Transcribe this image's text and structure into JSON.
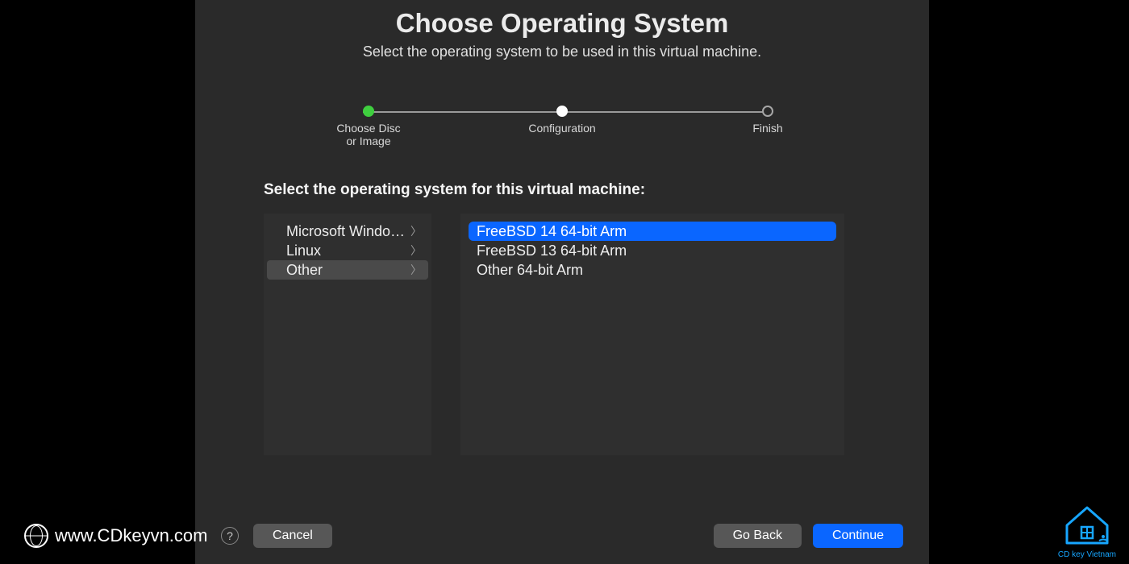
{
  "header": {
    "title": "Choose Operating System",
    "subtitle": "Select the operating system to be used in this virtual machine."
  },
  "stepper": {
    "steps": [
      {
        "label": "Choose Disc\nor Image",
        "state": "done"
      },
      {
        "label": "Configuration",
        "state": "current"
      },
      {
        "label": "Finish",
        "state": "future"
      }
    ]
  },
  "section_label": "Select the operating system for this virtual machine:",
  "categories": [
    {
      "label": "Microsoft Windo…",
      "selected": false
    },
    {
      "label": "Linux",
      "selected": false
    },
    {
      "label": "Other",
      "selected": true
    }
  ],
  "os_options": [
    {
      "label": "FreeBSD 14 64-bit Arm",
      "selected": true
    },
    {
      "label": "FreeBSD 13 64-bit Arm",
      "selected": false
    },
    {
      "label": "Other 64-bit Arm",
      "selected": false
    }
  ],
  "footer": {
    "help": "?",
    "cancel": "Cancel",
    "goback": "Go Back",
    "continue": "Continue"
  },
  "watermark": {
    "left": "www.CDkeyvn.com",
    "right": "CD key Vietnam"
  }
}
